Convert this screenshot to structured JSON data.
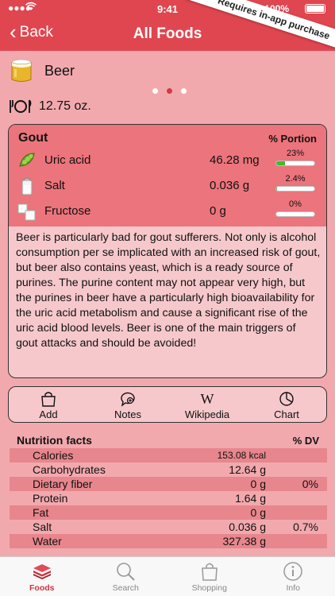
{
  "status": {
    "time": "9:41",
    "battery": "100%"
  },
  "nav": {
    "back_label": "Back",
    "title": "All Foods",
    "ribbon": "Requires in-app purchase"
  },
  "food": {
    "name": "Beer",
    "portion": "12.75 oz."
  },
  "pager": {
    "pages": 3,
    "active": 2
  },
  "gout": {
    "title": "Gout",
    "portion_header": "% Portion",
    "rows": [
      {
        "label": "Uric acid",
        "value": "46.28 mg",
        "pct": "23%",
        "fill": 0.23,
        "icon": "peas-icon"
      },
      {
        "label": "Salt",
        "value": "0.036 g",
        "pct": "2.4%",
        "fill": 0.024,
        "icon": "salt-shaker-icon"
      },
      {
        "label": "Fructose",
        "value": "0 g",
        "pct": "0%",
        "fill": 0.0,
        "icon": "sugar-cubes-icon"
      }
    ],
    "description": "Beer is particularly bad for gout sufferers. Not only is alcohol consumption per se implicated with an increased risk of gout, but beer also contains yeast, which is a ready source of purines. The purine content may not appear very high, but the purines in beer have a particularly high bioavailability for the uric acid metabolism and cause a significant rise of the uric acid blood levels. Beer is one of the main triggers of gout attacks and should be avoided!"
  },
  "actions": [
    {
      "label": "Add",
      "icon": "shopping-bag-icon"
    },
    {
      "label": "Notes",
      "icon": "notes-icon"
    },
    {
      "label": "Wikipedia",
      "icon": "wikipedia-icon"
    },
    {
      "label": "Chart",
      "icon": "pie-chart-icon"
    }
  ],
  "nutrition": {
    "title": "Nutrition facts",
    "dv_header": "% DV",
    "rows": [
      {
        "label": "Calories",
        "value": "153.08 kcal",
        "dv": ""
      },
      {
        "label": "Carbohydrates",
        "value": "12.64 g",
        "dv": ""
      },
      {
        "label": "Dietary fiber",
        "value": "0 g",
        "dv": "0%"
      },
      {
        "label": "Protein",
        "value": "1.64 g",
        "dv": ""
      },
      {
        "label": "Fat",
        "value": "0 g",
        "dv": ""
      },
      {
        "label": "Salt",
        "value": "0.036 g",
        "dv": "0.7%"
      },
      {
        "label": "Water",
        "value": "327.38 g",
        "dv": ""
      }
    ]
  },
  "tabs": [
    {
      "label": "Foods",
      "icon": "foods-icon",
      "active": true
    },
    {
      "label": "Search",
      "icon": "search-icon",
      "active": false
    },
    {
      "label": "Shopping",
      "icon": "shopping-bag-icon",
      "active": false
    },
    {
      "label": "Info",
      "icon": "info-icon",
      "active": false
    }
  ]
}
